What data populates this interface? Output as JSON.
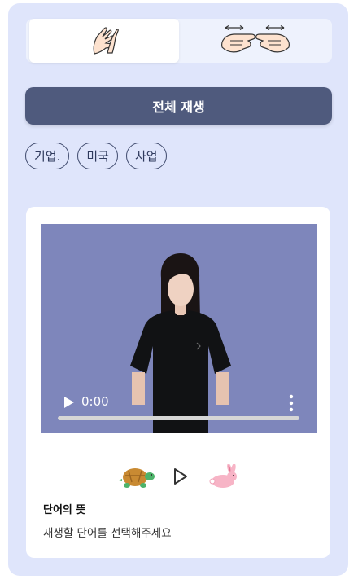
{
  "tabs": [
    {
      "icon": "one-hand-sign-icon",
      "selected": true
    },
    {
      "icon": "two-hands-sign-icon",
      "selected": false
    }
  ],
  "play_all_label": "전체 재생",
  "chips": [
    "기업.",
    "미국",
    "사업"
  ],
  "video": {
    "time": "0:00",
    "progress": 0
  },
  "speed_controls": {
    "slow_icon": "turtle-icon",
    "play_icon": "play-icon",
    "fast_icon": "rabbit-icon"
  },
  "word": {
    "title": "단어의 뜻",
    "description": "재생할 단어를 선택해주세요"
  },
  "colors": {
    "panel_bg": "#dfe5fb",
    "primary_button": "#4f5a7d",
    "video_bg": "#7e86bb"
  }
}
